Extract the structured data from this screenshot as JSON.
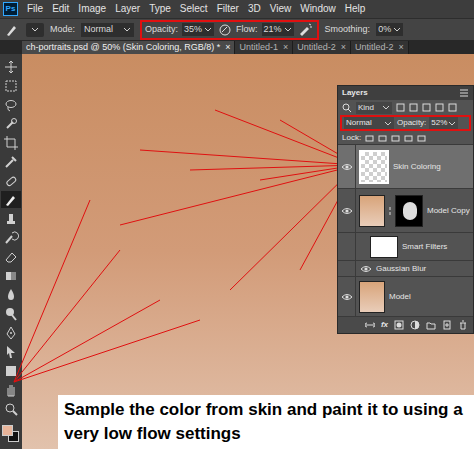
{
  "app": {
    "logo": "Ps"
  },
  "menu": [
    "File",
    "Edit",
    "Image",
    "Layer",
    "Type",
    "Select",
    "Filter",
    "3D",
    "View",
    "Window",
    "Help"
  ],
  "options": {
    "mode_label": "Mode:",
    "mode": "Normal",
    "opacity_label": "Opacity:",
    "opacity": "35%",
    "flow_label": "Flow:",
    "flow": "21%",
    "smoothing_label": "Smoothing:",
    "smoothing": "0%"
  },
  "doc_tabs": [
    {
      "label": "ch-portraits.psd @ 50% (Skin Coloring, RGB/8) *",
      "close": "×",
      "selected": true
    },
    {
      "label": "Untitled-1",
      "close": "×",
      "selected": false
    },
    {
      "label": "Untitled-2",
      "close": "×",
      "selected": false
    },
    {
      "label": "Untitled-2",
      "close": "×",
      "selected": false
    }
  ],
  "layers_panel": {
    "title": "Layers",
    "filter": "Kind",
    "blend": "Normal",
    "opacity_label": "Opacity:",
    "opacity": "52%",
    "lock_label": "Lock:",
    "fx_label": "fx",
    "layers": [
      {
        "name": "Skin Coloring",
        "kind": "empty",
        "selected": true,
        "visible": true
      },
      {
        "name": "Model Copy",
        "kind": "masked",
        "selected": false,
        "visible": true
      },
      {
        "name": "Smart Filters",
        "kind": "filter-mask",
        "selected": false,
        "visible": false
      },
      {
        "name": "Gaussian Blur",
        "kind": "filter",
        "selected": false,
        "visible": true
      },
      {
        "name": "Model",
        "kind": "photo",
        "selected": false,
        "visible": true
      }
    ]
  },
  "caption": "Sample the color from skin and paint it to using a very low flow settings"
}
